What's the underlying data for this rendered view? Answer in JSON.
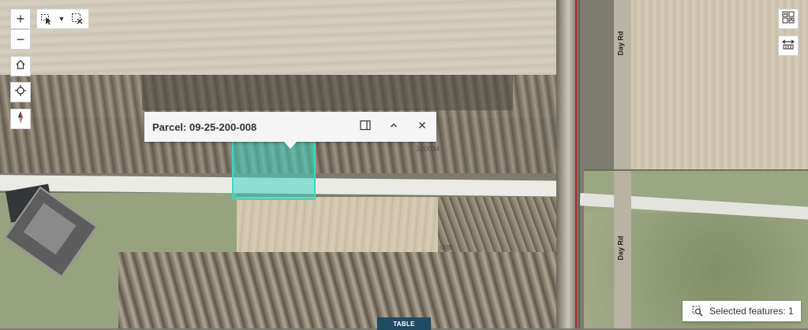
{
  "map": {
    "road_labels": [
      "Day Rd",
      "Day Rd"
    ],
    "parcel_numbers": [
      "320034",
      "008"
    ],
    "parcel_fill": "#40d6c4",
    "boundary_color": "#b3262b"
  },
  "controls": {
    "zoom_in": "+",
    "zoom_out": "−",
    "icons": [
      "home-icon",
      "locate-icon",
      "compass-icon",
      "select-icon",
      "clear-selection-icon",
      "basemap-icon",
      "swipe-icon"
    ]
  },
  "popup": {
    "title": "Parcel: 09-25-200-008"
  },
  "table_tab": {
    "label": "TABLE"
  },
  "selected_panel": {
    "label": "Selected features: 1"
  }
}
